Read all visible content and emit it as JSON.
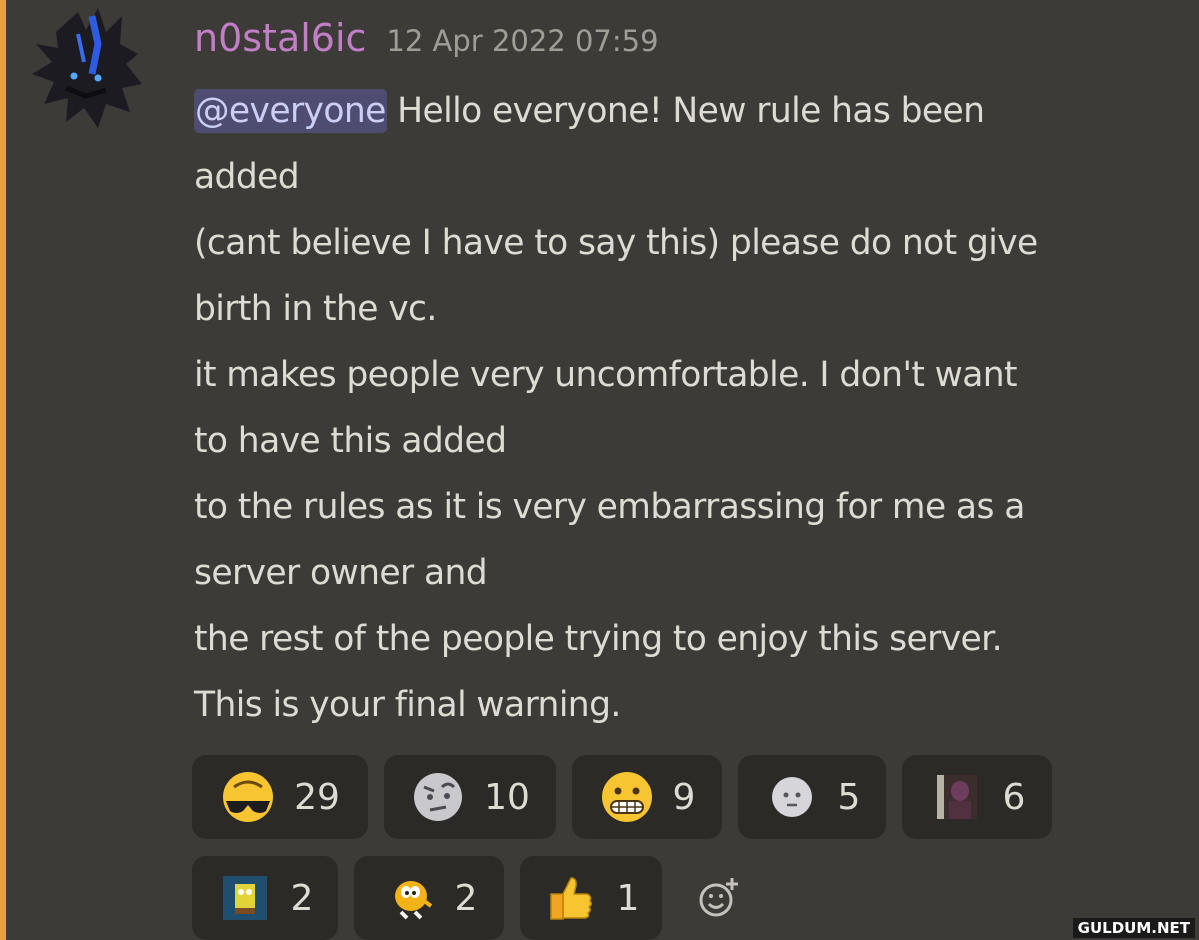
{
  "message": {
    "username": "n0stal6ic",
    "timestamp": "12 Apr 2022 07:59",
    "mention": "@everyone",
    "lines": [
      " Hello everyone! New rule has been",
      "added",
      "(cant believe I have to say this) please do not give",
      "birth in the vc.",
      "it makes people very uncomfortable. I don't want",
      "to have this added",
      "to the rules as it is very embarrassing for me as a",
      "server owner and",
      "the rest of the people trying to enjoy this server.",
      "This is your final warning."
    ]
  },
  "reactions": [
    {
      "emoji": "sunglasses-upside-down-emoji",
      "count": "29"
    },
    {
      "emoji": "raised-eyebrow-face-emoji",
      "count": "10"
    },
    {
      "emoji": "grimacing-face-emoji",
      "count": "9"
    },
    {
      "emoji": "grey-blank-face-emoji",
      "count": "5"
    },
    {
      "emoji": "custom-photo-emoji",
      "count": "6"
    },
    {
      "emoji": "custom-sponge-emoji",
      "count": "2"
    },
    {
      "emoji": "yellow-character-emoji",
      "count": "2"
    },
    {
      "emoji": "thumbs-up-emoji",
      "count": "1"
    }
  ],
  "add_reaction_icon": "add-reaction-icon",
  "colors": {
    "background": "#3d3b37",
    "mention_bar": "#e3a33a",
    "username": "#c27ec7",
    "mention_bg": "#4f4c72",
    "reaction_bg": "#2c2a27"
  },
  "watermark": "GULDUM.NET"
}
